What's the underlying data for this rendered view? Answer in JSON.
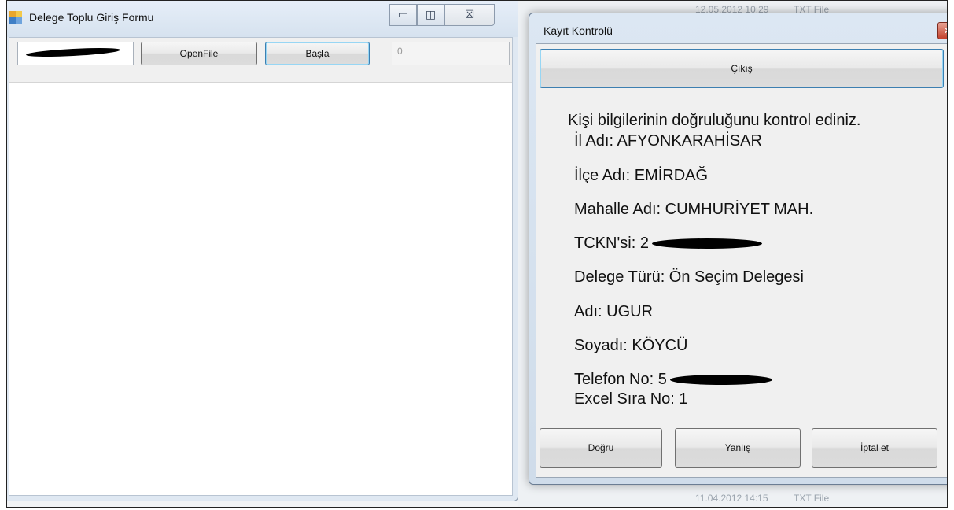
{
  "background": {
    "rows": [
      {
        "date": "12.05.2012 10:29",
        "type": "TXT File"
      },
      {
        "date": "11.04.2012 14:15",
        "type": "TXT File"
      }
    ]
  },
  "main_window": {
    "title": "Delege Toplu Giriş Formu",
    "controls": {
      "minimize": "▭",
      "maximize": "◫",
      "close": "☒"
    },
    "toolbar": {
      "openfile_label": "OpenFile",
      "basla_label": "Başla",
      "counter_value": "0"
    }
  },
  "dialog": {
    "title": "Kayıt Kontrolü",
    "close_glyph": "✕",
    "exit_button": "Çıkış",
    "intro": "Kişi bilgilerinin doğruluğunu kontrol ediniz.",
    "fields": {
      "il": "İl Adı: AFYONKARAHİSAR",
      "ilce": "İlçe Adı: EMİRDAĞ",
      "mahalle": "Mahalle Adı: CUMHURİYET MAH.",
      "tckn_label": "TCKN'si: ",
      "tckn_visible": "2",
      "delege_turu": "Delege Türü: Ön Seçim Delegesi",
      "ad": "Adı: UGUR",
      "soyad": "Soyadı: KÖYCÜ",
      "telefon_label": "Telefon No: ",
      "telefon_visible": "5",
      "excel_sira": "Excel Sıra No: 1"
    },
    "buttons": {
      "dogru": "Doğru",
      "yanlis": "Yanlış",
      "iptal": "İptal et"
    }
  },
  "colors": {
    "title_bar": "#dfe8f2",
    "focus_border": "#3c7fb1",
    "close_red": "#c4412c"
  }
}
